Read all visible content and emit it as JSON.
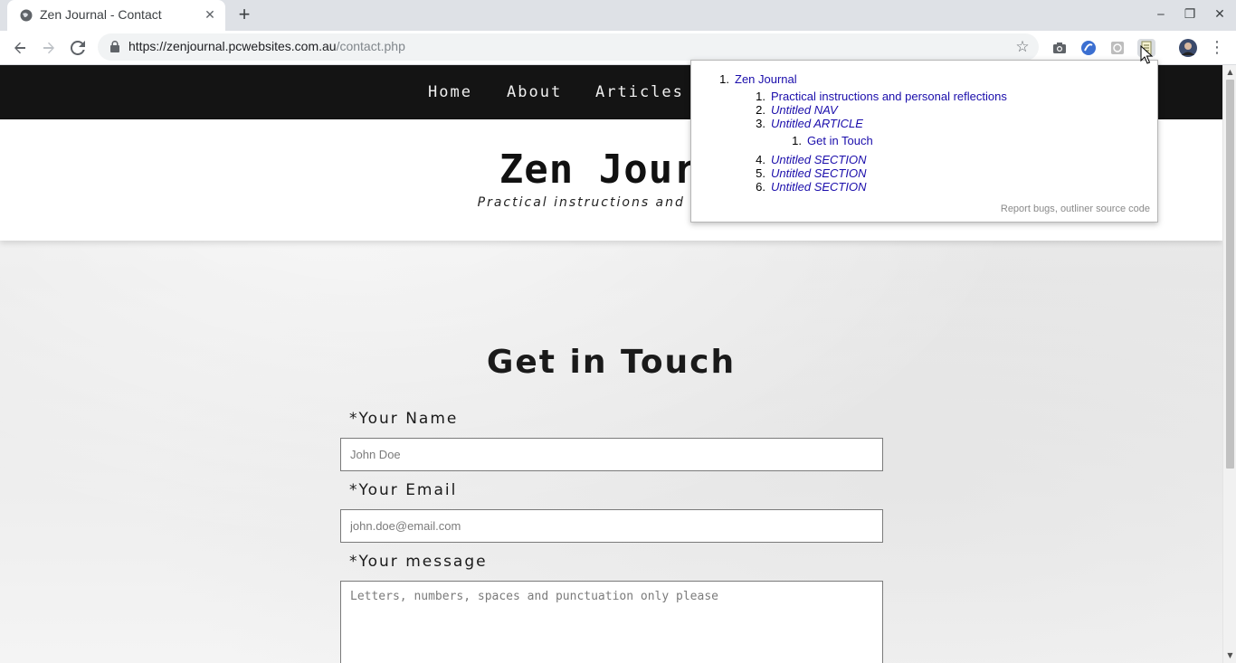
{
  "browser": {
    "tab_title": "Zen Journal - Contact",
    "url_host": "https://zenjournal.pcwebsites.com.au",
    "url_path": "/contact.php"
  },
  "site": {
    "nav": [
      "Home",
      "About",
      "Articles"
    ],
    "title": "Zen Journ",
    "tagline": "Practical instructions and person"
  },
  "contact": {
    "heading": "Get in Touch",
    "name_label": "*Your Name",
    "name_placeholder": "John Doe",
    "email_label": "*Your Email",
    "email_placeholder": "john.doe@email.com",
    "message_label": "*Your message",
    "message_placeholder": "Letters, numbers, spaces and punctuation only please"
  },
  "outline": {
    "root": "Zen Journal",
    "items": [
      "Practical instructions and personal reflections",
      "Untitled NAV",
      "Untitled ARTICLE",
      "Untitled SECTION",
      "Untitled SECTION",
      "Untitled SECTION"
    ],
    "sub_item": "Get in Touch",
    "numbers": [
      "1.",
      "2.",
      "3.",
      "4.",
      "5.",
      "6."
    ],
    "footer_report": "Report bugs",
    "footer_sep": ",",
    "footer_source": "outliner source code"
  },
  "icons": {
    "back": "back-arrow-icon",
    "forward": "forward-arrow-icon",
    "reload": "reload-icon",
    "star": "bookmark-star-icon",
    "extension_active": "document-outline-icon"
  },
  "colors": {
    "nav_bg": "#141414",
    "link": "#1a0dab"
  }
}
